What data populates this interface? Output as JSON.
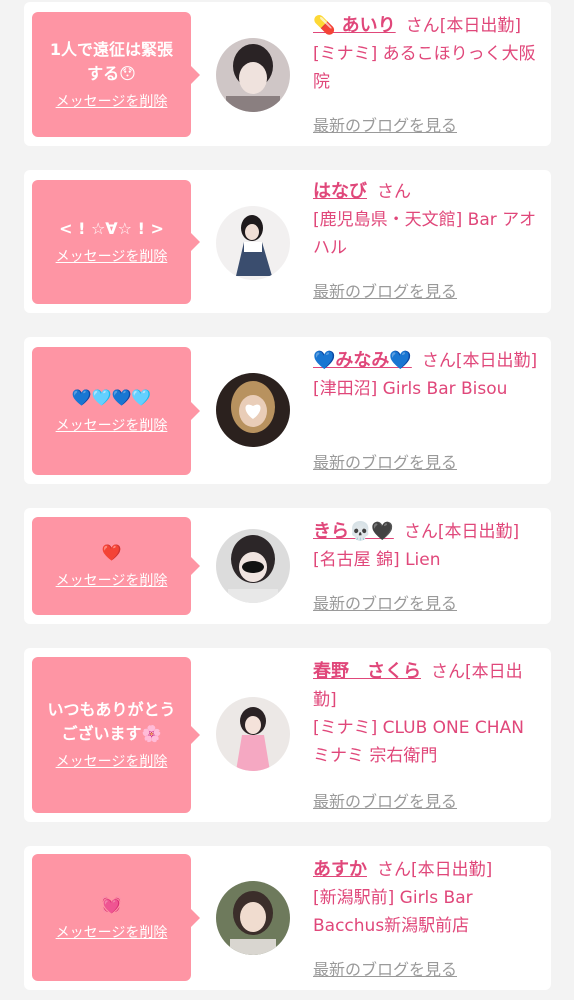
{
  "colors": {
    "bubble": "#fe95a4",
    "name": "#e0477a",
    "link": "#9a9a9a",
    "bg": "#f3f3f3"
  },
  "delete_label": "メッセージを削除",
  "blog_label": "最新のブログを見る",
  "san_label": "さん",
  "cards": [
    {
      "message": "1人で遠征は緊張する😯",
      "name": "💊 あいり",
      "status": "[本日出勤]",
      "shop": "[ミナミ] あるこほりっく大阪院"
    },
    {
      "message": "< ! ☆∀☆ ! >",
      "name": "はなび",
      "status": "",
      "shop": "[鹿児島県・天文館] Bar アオハル"
    },
    {
      "message": "💙🩵💙🩵",
      "name": "💙みなみ💙",
      "status": "[本日出勤]",
      "shop": "[津田沼] Girls Bar Bisou"
    },
    {
      "message": "❤️",
      "name": "きら💀🖤",
      "status": "[本日出勤]",
      "shop": "[名古屋 錦] Lien"
    },
    {
      "message": "いつもありがとうございます🌸",
      "name": "春野　さくら",
      "status": "[本日出勤]",
      "shop": "[ミナミ] CLUB ONE CHAN ミナミ 宗右衛門"
    },
    {
      "message": "💓",
      "name": "あすか",
      "status": "[本日出勤]",
      "shop": "[新潟駅前] Girls Bar Bacchus新潟駅前店"
    }
  ]
}
